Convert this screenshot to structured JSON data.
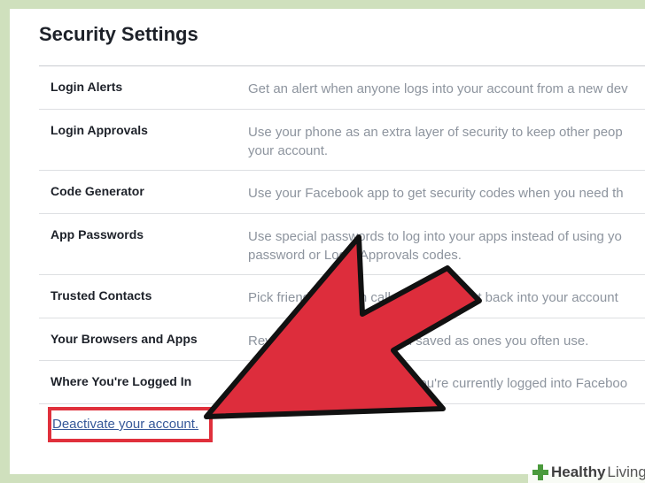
{
  "page": {
    "title": "Security Settings"
  },
  "settings": [
    {
      "label": "Login Alerts",
      "description": "Get an alert when anyone logs into your account from a new dev"
    },
    {
      "label": "Login Approvals",
      "description": "Use your phone as an extra layer of security to keep other peop",
      "description2": "your account."
    },
    {
      "label": "Code Generator",
      "description": "Use your Facebook app to get security codes when you need th"
    },
    {
      "label": "App Passwords",
      "description": "Use special passwords to log into your apps instead of using yo",
      "description2": "password or Login Approvals codes."
    },
    {
      "label": "Trusted Contacts",
      "description": "Pick friends you can call to help you get back into your account"
    },
    {
      "label": "Your Browsers and Apps",
      "description": "Review which browsers you saved as ones you often use."
    },
    {
      "label": "Where You're Logged In",
      "description": "Review and manage where you're currently logged into Faceboo"
    }
  ],
  "deactivate": {
    "label": "Deactivate your account."
  },
  "watermark": {
    "brand": "Healthy",
    "brand2": "Living"
  },
  "colors": {
    "arrow": "#dd2d3c",
    "highlight_box": "#e0303c",
    "link": "#365899",
    "background": "#cfe0bd"
  },
  "icons": {
    "watermark_logo": "plus-cross-icon",
    "pointer": "arrow-pointer-icon"
  }
}
